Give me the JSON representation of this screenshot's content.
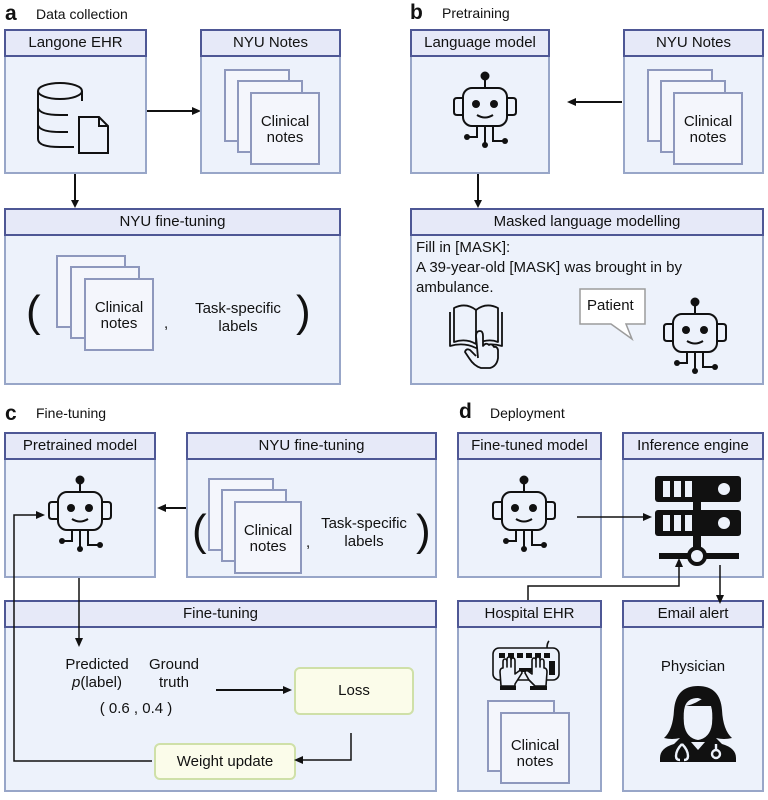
{
  "panels": {
    "a": {
      "letter": "a",
      "title": "Data collection",
      "langone_ehr": {
        "header": "Langone EHR",
        "icon": "database-document-icon"
      },
      "nyu_notes": {
        "header": "NYU Notes",
        "page_label": "Clinical notes",
        "page_label_l1": "Clinical",
        "page_label_l2": "notes"
      },
      "nyu_finetuning": {
        "header": "NYU fine-tuning",
        "open_paren": "(",
        "close_paren": ")",
        "comma": ",",
        "page_label_l1": "Clinical",
        "page_label_l2": "notes",
        "labels_l1": "Task-specific",
        "labels_l2": "labels"
      }
    },
    "b": {
      "letter": "b",
      "title": "Pretraining",
      "language_model": {
        "header": "Language model",
        "icon": "robot-icon"
      },
      "nyu_notes": {
        "header": "NYU Notes",
        "page_label_l1": "Clinical",
        "page_label_l2": "notes"
      },
      "mlm": {
        "header": "Masked language modelling",
        "line1": "Fill in [MASK]:",
        "line2": "A 39-year-old [MASK] was brought in by",
        "line3": "ambulance.",
        "speech_bubble": "Patient",
        "icons": [
          "book-pointing-hand-icon",
          "robot-icon"
        ]
      }
    },
    "c": {
      "letter": "c",
      "title": "Fine-tuning",
      "pretrained_model": {
        "header": "Pretrained model",
        "icon": "robot-icon"
      },
      "nyu_finetuning": {
        "header": "NYU fine-tuning",
        "open_paren": "(",
        "close_paren": ")",
        "comma": ",",
        "page_label_l1": "Clinical",
        "page_label_l2": "notes",
        "labels_l1": "Task-specific",
        "labels_l2": "labels"
      },
      "finetuning": {
        "header": "Fine-tuning",
        "predicted_l1": "Predicted",
        "predicted_l2_italic": "p",
        "predicted_l2_rest": "(label)",
        "ground_truth_l1": "Ground",
        "ground_truth_l2": "truth",
        "tuple": "( 0.6 , 0.4 )",
        "loss": "Loss",
        "weight_update": "Weight update"
      }
    },
    "d": {
      "letter": "d",
      "title": "Deployment",
      "finetuned_model": {
        "header": "Fine-tuned model",
        "icon": "robot-icon"
      },
      "inference_engine": {
        "header": "Inference engine",
        "icon": "server-network-icon"
      },
      "hospital_ehr": {
        "header": "Hospital EHR",
        "icon": "keyboard-hands-icon",
        "page_label_l1": "Clinical",
        "page_label_l2": "notes"
      },
      "email_alert": {
        "header": "Email alert",
        "label": "Physician",
        "icon": "physician-icon"
      }
    }
  },
  "colors": {
    "box_fill": "#edf2fb",
    "box_border": "#98a6c8",
    "header_fill": "#e6e9f8",
    "header_border": "#4e5795",
    "page_border": "#8e98bd",
    "green_fill": "#fbfcea",
    "green_border": "#cfe0a8"
  }
}
